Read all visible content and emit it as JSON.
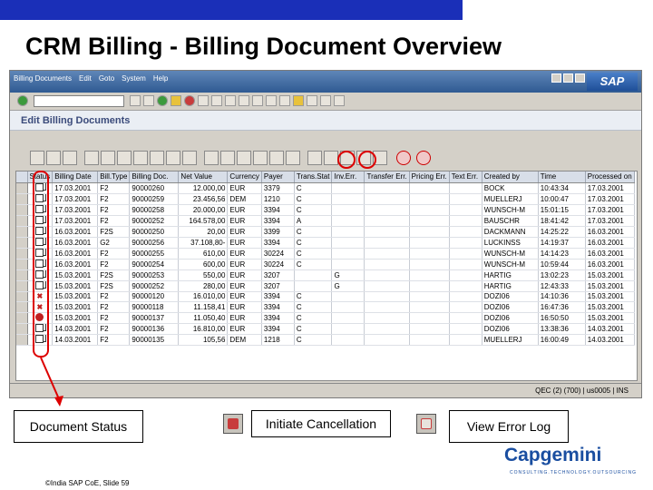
{
  "slide": {
    "title": "CRM Billing - Billing Document Overview"
  },
  "sap": {
    "menu": [
      "Billing Documents",
      "Edit",
      "Goto",
      "System",
      "Help"
    ],
    "logo": "SAP",
    "pane_title": "Edit Billing Documents",
    "status_text": "QEC (2) (700) | us0005 | INS"
  },
  "table": {
    "columns": [
      "Status",
      "Billing Date",
      "Bill.Type",
      "Billing Doc.",
      "Net Value",
      "Currency",
      "Payer",
      "Trans.Stat",
      "Inv.Err.",
      "Transfer Err.",
      "Pricing Err.",
      "Text Err.",
      "Created by",
      "Time",
      "Processed on"
    ],
    "rows": [
      {
        "status": "doc",
        "date": "17.03.2001",
        "type": "F2",
        "doc": "90000260",
        "net": "12.000,00",
        "curr": "EUR",
        "payer": "3379",
        "ts": "C",
        "e1": "",
        "e2": "",
        "e3": "",
        "e4": "",
        "by": "BOCK",
        "time": "10:43:34",
        "proc": "17.03.2001"
      },
      {
        "status": "doc",
        "date": "17.03.2001",
        "type": "F2",
        "doc": "90000259",
        "net": "23.456,56",
        "curr": "DEM",
        "payer": "1210",
        "ts": "C",
        "e1": "",
        "e2": "",
        "e3": "",
        "e4": "",
        "by": "MUELLERJ",
        "time": "10:00:47",
        "proc": "17.03.2001"
      },
      {
        "status": "doc",
        "date": "17.03.2001",
        "type": "F2",
        "doc": "90000258",
        "net": "20.000,00",
        "curr": "EUR",
        "payer": "3394",
        "ts": "C",
        "e1": "",
        "e2": "",
        "e3": "",
        "e4": "",
        "by": "WUNSCH-M",
        "time": "15:01:15",
        "proc": "17.03.2001"
      },
      {
        "status": "doc",
        "date": "17.03.2001",
        "type": "F2",
        "doc": "90000252",
        "net": "164.578,00",
        "curr": "EUR",
        "payer": "3394",
        "ts": "A",
        "e1": "",
        "e2": "",
        "e3": "",
        "e4": "",
        "by": "BAUSCHR",
        "time": "18:41:42",
        "proc": "17.03.2001"
      },
      {
        "status": "doc",
        "date": "16.03.2001",
        "type": "F2S",
        "doc": "90000250",
        "net": "20,00",
        "curr": "EUR",
        "payer": "3399",
        "ts": "C",
        "e1": "",
        "e2": "",
        "e3": "",
        "e4": "",
        "by": "DACKMANN",
        "time": "14:25:22",
        "proc": "16.03.2001"
      },
      {
        "status": "doc",
        "date": "16.03.2001",
        "type": "G2",
        "doc": "90000256",
        "net": "37.108,80-",
        "curr": "EUR",
        "payer": "3394",
        "ts": "C",
        "e1": "",
        "e2": "",
        "e3": "",
        "e4": "",
        "by": "LUCKINSS",
        "time": "14:19:37",
        "proc": "16.03.2001"
      },
      {
        "status": "doc",
        "date": "16.03.2001",
        "type": "F2",
        "doc": "90000255",
        "net": "610,00",
        "curr": "EUR",
        "payer": "30224",
        "ts": "C",
        "e1": "",
        "e2": "",
        "e3": "",
        "e4": "",
        "by": "WUNSCH-M",
        "time": "14:14:23",
        "proc": "16.03.2001"
      },
      {
        "status": "doc",
        "date": "16.03.2001",
        "type": "F2",
        "doc": "90000254",
        "net": "600,00",
        "curr": "EUR",
        "payer": "30224",
        "ts": "C",
        "e1": "",
        "e2": "",
        "e3": "",
        "e4": "",
        "by": "WUNSCH-M",
        "time": "10:59:44",
        "proc": "16.03.2001"
      },
      {
        "status": "doc",
        "date": "15.03.2001",
        "type": "F2S",
        "doc": "90000253",
        "net": "550,00",
        "curr": "EUR",
        "payer": "3207",
        "ts": "",
        "e1": "G",
        "e2": "",
        "e3": "",
        "e4": "",
        "by": "HARTIG",
        "time": "13:02:23",
        "proc": "15.03.2001"
      },
      {
        "status": "doc",
        "date": "15.03.2001",
        "type": "F2S",
        "doc": "90000252",
        "net": "280,00",
        "curr": "EUR",
        "payer": "3207",
        "ts": "",
        "e1": "G",
        "e2": "",
        "e3": "",
        "e4": "",
        "by": "HARTIG",
        "time": "12:43:33",
        "proc": "15.03.2001"
      },
      {
        "status": "x",
        "date": "15.03.2001",
        "type": "F2",
        "doc": "90000120",
        "net": "16.010,00",
        "curr": "EUR",
        "payer": "3394",
        "ts": "C",
        "e1": "",
        "e2": "",
        "e3": "",
        "e4": "",
        "by": "DOZI06",
        "time": "14:10:36",
        "proc": "15.03.2001"
      },
      {
        "status": "x",
        "date": "15.03.2001",
        "type": "F2",
        "doc": "90000118",
        "net": "11.158,41",
        "curr": "EUR",
        "payer": "3394",
        "ts": "C",
        "e1": "",
        "e2": "",
        "e3": "",
        "e4": "",
        "by": "DOZI06",
        "time": "16:47:36",
        "proc": "15.03.2001"
      },
      {
        "status": "err",
        "date": "15.03.2001",
        "type": "F2",
        "doc": "90000137",
        "net": "11.050,40",
        "curr": "EUR",
        "payer": "3394",
        "ts": "C",
        "e1": "",
        "e2": "",
        "e3": "",
        "e4": "",
        "by": "DOZI06",
        "time": "16:50:50",
        "proc": "15.03.2001"
      },
      {
        "status": "doc",
        "date": "14.03.2001",
        "type": "F2",
        "doc": "90000136",
        "net": "16.810,00",
        "curr": "EUR",
        "payer": "3394",
        "ts": "C",
        "e1": "",
        "e2": "",
        "e3": "",
        "e4": "",
        "by": "DOZI06",
        "time": "13:38:36",
        "proc": "14.03.2001"
      },
      {
        "status": "doc",
        "date": "14.03.2001",
        "type": "F2",
        "doc": "90000135",
        "net": "105,56",
        "curr": "DEM",
        "payer": "1218",
        "ts": "C",
        "e1": "",
        "e2": "",
        "e3": "",
        "e4": "",
        "by": "MUELLERJ",
        "time": "16:00:49",
        "proc": "14.03.2001"
      }
    ]
  },
  "legend": {
    "document_status": "Document Status",
    "initiate_cancellation": "Initiate Cancellation",
    "view_error_log": "View Error Log"
  },
  "footer": {
    "copyright": "©India SAP CoE, Slide 59",
    "brand": "Capgemini",
    "tagline": "CONSULTING.TECHNOLOGY.OUTSOURCING"
  },
  "colors": {
    "header_bar": "#1a2fb8",
    "highlight": "#dd0000",
    "brand": "#1a4ea0"
  }
}
